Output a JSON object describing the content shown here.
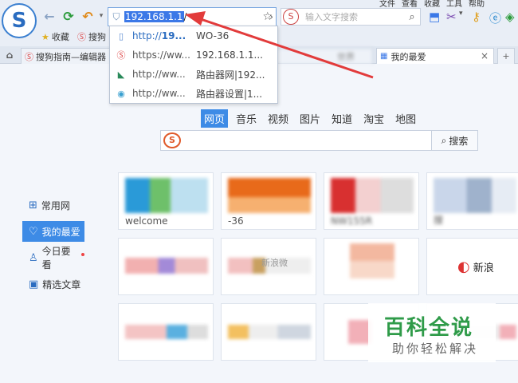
{
  "menu": {
    "items": [
      "文件",
      "查看",
      "收藏",
      "工具",
      "帮助"
    ]
  },
  "addressbar": {
    "url_selected": "192.168.1.1",
    "url_cursor": "/"
  },
  "searchbox": {
    "placeholder": "输入文字搜索"
  },
  "bookmarks": {
    "favorites_label": "收藏",
    "sogou_label": "搜狗"
  },
  "tabs": [
    {
      "label": "搜狗指南—编辑器"
    },
    {
      "label": "世界"
    },
    {
      "label": "我的最爱"
    }
  ],
  "dropdown": [
    {
      "url_prefix": "http://",
      "url_bold": "19...",
      "title": "WO-36"
    },
    {
      "url_prefix": "https://ww...",
      "url_bold": "",
      "title": "192.168.1.1..."
    },
    {
      "url_prefix": "http://ww...",
      "url_bold": "",
      "title": "路由器网|192..."
    },
    {
      "url_prefix": "http://ww...",
      "url_bold": "",
      "title": "路由器设置|1..."
    }
  ],
  "categories": [
    "网页",
    "音乐",
    "视频",
    "图片",
    "知道",
    "淘宝",
    "地图"
  ],
  "main_search": {
    "button": "搜索"
  },
  "sidenav": [
    {
      "label": "常用网"
    },
    {
      "label": "我的最爱"
    },
    {
      "label": "今日要看"
    },
    {
      "label": "精选文章"
    }
  ],
  "tiles": [
    {
      "caption": "welcome"
    },
    {
      "caption": "-36"
    },
    {
      "caption": "NW155R"
    },
    {
      "caption": "搜"
    },
    {
      "caption": ""
    },
    {
      "caption": "新浪微"
    },
    {
      "caption": ""
    },
    {
      "caption": "新浪"
    },
    {
      "caption": ""
    },
    {
      "caption": ""
    },
    {
      "caption": ""
    },
    {
      "caption": ""
    }
  ],
  "watermark": {
    "title": "百科全说",
    "subtitle": "助你轻松解决"
  },
  "colors": {
    "accent": "#3d8be6",
    "arrow": "#e23b3b",
    "watermark_green": "#2f9b49"
  }
}
